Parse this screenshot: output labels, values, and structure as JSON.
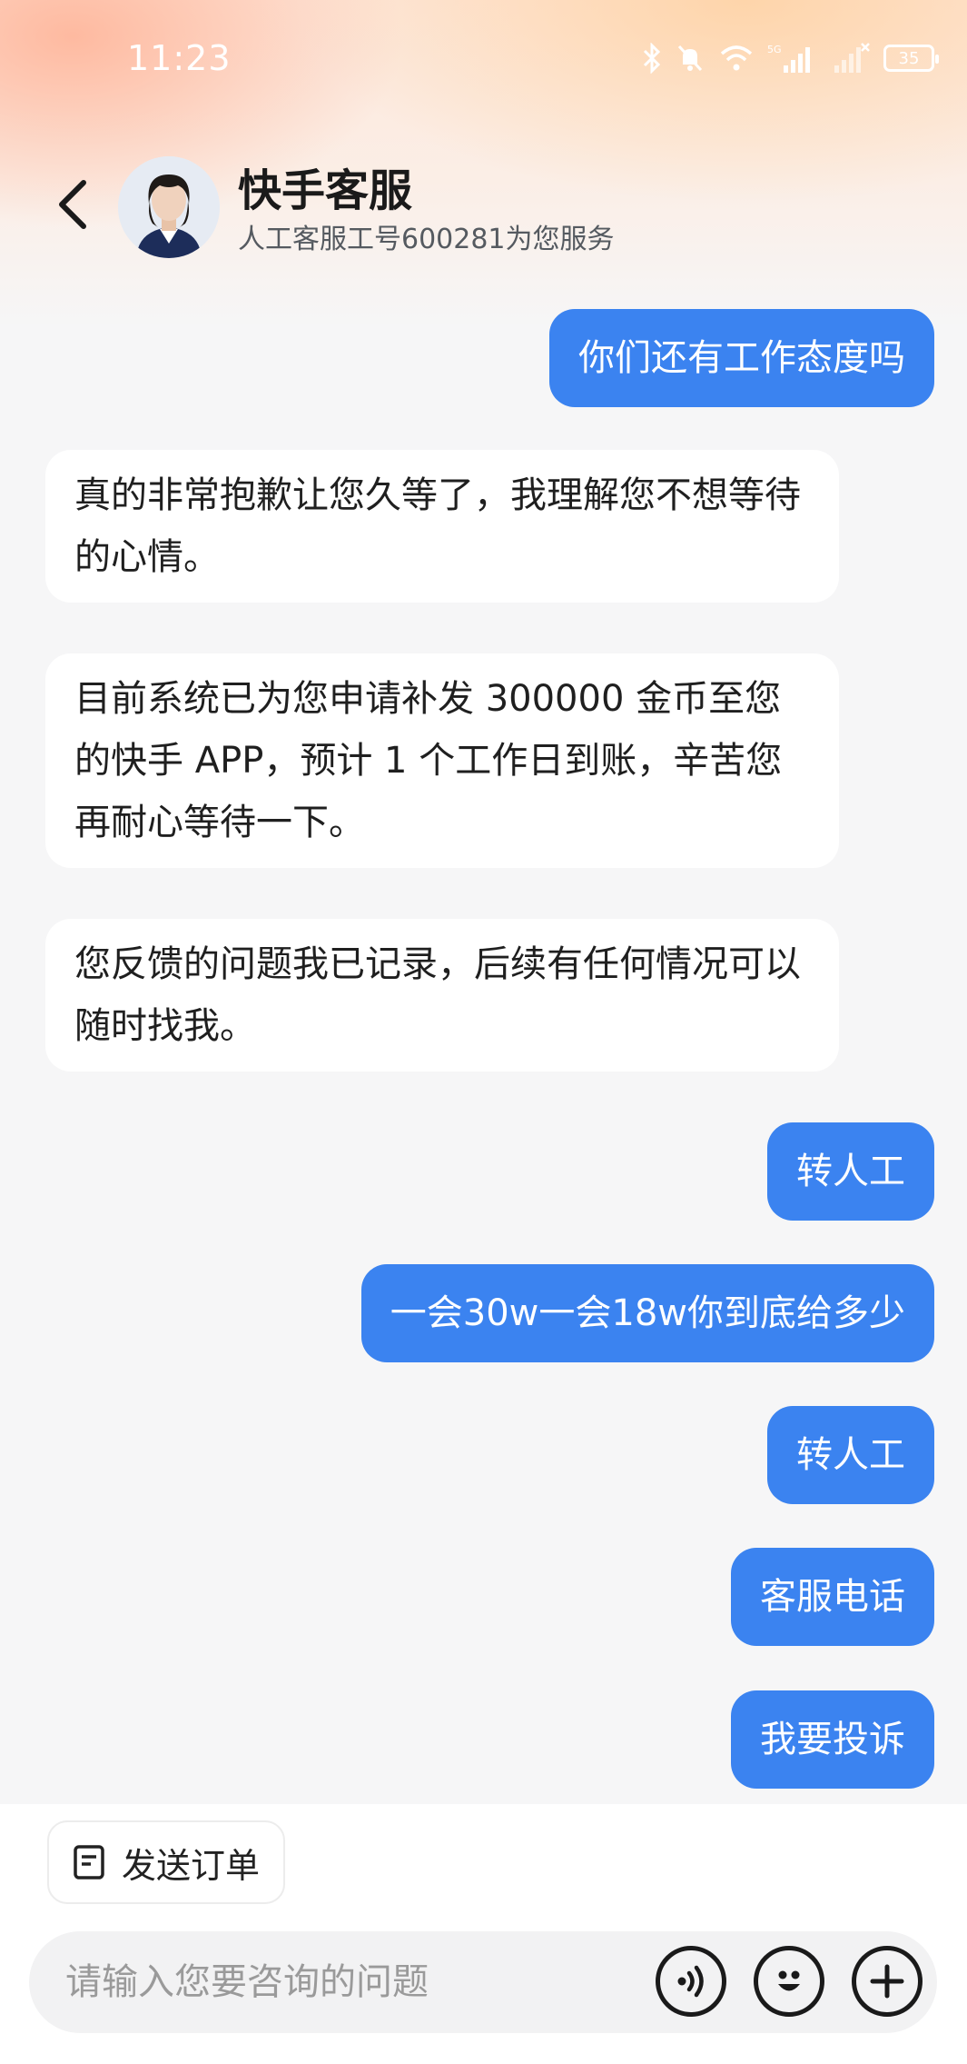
{
  "status_bar": {
    "time": "11:23",
    "network": "5G",
    "battery": "35"
  },
  "header": {
    "title": "快手客服",
    "subtitle": "人工客服工号600281为您服务"
  },
  "messages": [
    {
      "from": "user",
      "text": "你们还有工作态度吗"
    },
    {
      "from": "agent",
      "text": "真的非常抱歉让您久等了，我理解您不想等待的心情。"
    },
    {
      "from": "agent",
      "text": "目前系统已为您申请补发 300000 金币至您的快手 APP，预计 1 个工作日到账，辛苦您再耐心等待一下。"
    },
    {
      "from": "agent",
      "text": "您反馈的问题我已记录，后续有任何情况可以随时找我。"
    },
    {
      "from": "user",
      "text": "转人工"
    },
    {
      "from": "user",
      "text": "一会30w一会18w你到底给多少"
    },
    {
      "from": "user",
      "text": "转人工"
    },
    {
      "from": "user",
      "text": "客服电话"
    },
    {
      "from": "user",
      "text": "我要投诉"
    }
  ],
  "bottom": {
    "order_button": "发送订单",
    "input_placeholder": "请输入您要咨询的问题"
  },
  "colors": {
    "user_bubble": "#3b83f0",
    "agent_bubble": "#ffffff",
    "background": "#f6f6f7"
  }
}
